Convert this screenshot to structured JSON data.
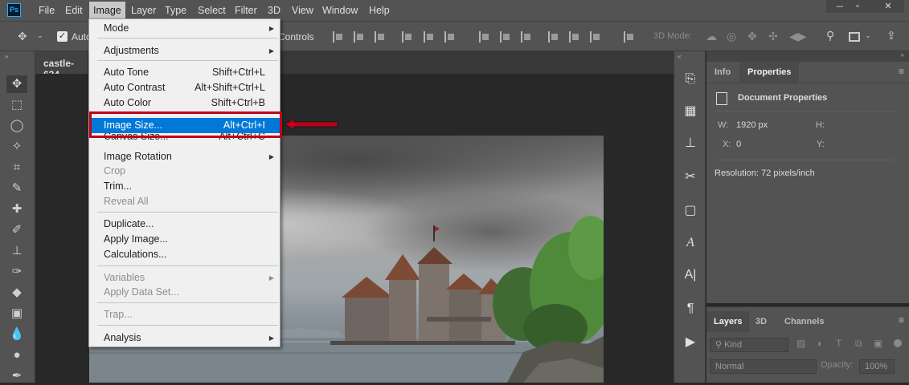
{
  "menubar": {
    "items": [
      "File",
      "Edit",
      "Image",
      "Layer",
      "Type",
      "Select",
      "Filter",
      "3D",
      "View",
      "Window",
      "Help"
    ],
    "logo": "Ps",
    "window_controls": [
      "minimize-icon",
      "maximize-icon",
      "close-icon"
    ]
  },
  "options": {
    "auto_label": "Auto",
    "controls_label": "Controls",
    "three_d_mode": "3D Mode:"
  },
  "document": {
    "tab_title": "castle-624"
  },
  "image_menu": {
    "items": [
      {
        "label": "Mode",
        "shortcut": "",
        "submenu": true,
        "disabled": false
      },
      {
        "label": "Adjustments",
        "shortcut": "",
        "submenu": true,
        "disabled": false
      },
      {
        "label": "Auto Tone",
        "shortcut": "Shift+Ctrl+L",
        "submenu": false,
        "disabled": false
      },
      {
        "label": "Auto Contrast",
        "shortcut": "Alt+Shift+Ctrl+L",
        "submenu": false,
        "disabled": false
      },
      {
        "label": "Auto Color",
        "shortcut": "Shift+Ctrl+B",
        "submenu": false,
        "disabled": false
      },
      {
        "label": "Image Size...",
        "shortcut": "Alt+Ctrl+I",
        "submenu": false,
        "disabled": false,
        "highlighted": true
      },
      {
        "label": "Canvas Size...",
        "shortcut": "Alt+Ctrl+C",
        "submenu": false,
        "disabled": false
      },
      {
        "label": "Image Rotation",
        "shortcut": "",
        "submenu": true,
        "disabled": false
      },
      {
        "label": "Crop",
        "shortcut": "",
        "submenu": false,
        "disabled": true
      },
      {
        "label": "Trim...",
        "shortcut": "",
        "submenu": false,
        "disabled": false
      },
      {
        "label": "Reveal All",
        "shortcut": "",
        "submenu": false,
        "disabled": true
      },
      {
        "label": "Duplicate...",
        "shortcut": "",
        "submenu": false,
        "disabled": false
      },
      {
        "label": "Apply Image...",
        "shortcut": "",
        "submenu": false,
        "disabled": false
      },
      {
        "label": "Calculations...",
        "shortcut": "",
        "submenu": false,
        "disabled": false
      },
      {
        "label": "Variables",
        "shortcut": "",
        "submenu": true,
        "disabled": true
      },
      {
        "label": "Apply Data Set...",
        "shortcut": "",
        "submenu": false,
        "disabled": true
      },
      {
        "label": "Trap...",
        "shortcut": "",
        "submenu": false,
        "disabled": true
      },
      {
        "label": "Analysis",
        "shortcut": "",
        "submenu": true,
        "disabled": false
      }
    ]
  },
  "properties_panel": {
    "tabs": [
      "Info",
      "Properties"
    ],
    "active_tab": "Properties",
    "section_title": "Document Properties",
    "w_label": "W:",
    "w_value": "1920 px",
    "h_label": "H:",
    "x_label": "X:",
    "x_value": "0",
    "y_label": "Y:",
    "resolution": "Resolution: 72 pixels/inch"
  },
  "layers_panel": {
    "tabs": [
      "Layers",
      "3D",
      "Channels"
    ],
    "active_tab": "Layers",
    "kind_label": "Kind",
    "blend_mode": "Normal",
    "opacity_label": "Opacity:",
    "opacity_value": "100%"
  },
  "colors": {
    "ui_dark": "#282828",
    "ui_panel": "#535353",
    "menu_highlight": "#0078d7",
    "annotation_red": "#c0001a"
  }
}
